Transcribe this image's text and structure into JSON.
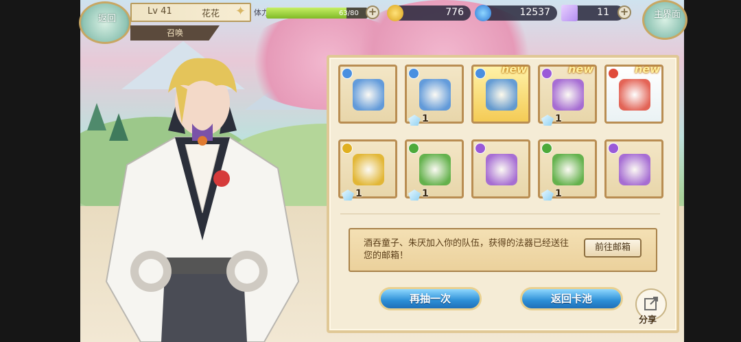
{
  "header": {
    "back_label": "返回",
    "level": "Lv 41",
    "player_name": "花花",
    "summon_tag": "召唤",
    "stamina_label": "体力",
    "stamina_value": "63/80",
    "stamina_fraction": 0.79,
    "gold": "776",
    "gems": "12537",
    "crystals": "11",
    "home_label": "主界面"
  },
  "items": [
    {
      "element_color": "#4a8fe0",
      "new": "",
      "count": "",
      "icon": "mask-artifact-icon"
    },
    {
      "element_color": "#4a8fe0",
      "new": "",
      "count": "1",
      "icon": "gourd-icon"
    },
    {
      "element_color": "#4a8fe0",
      "new": "new",
      "count": "",
      "icon": "dragon-disc-icon"
    },
    {
      "element_color": "#9a5ad8",
      "new": "new",
      "count": "1",
      "icon": "star-shuriken-icon"
    },
    {
      "element_color": "#e04a3a",
      "new": "new",
      "count": "",
      "icon": "golden-rings-icon"
    },
    {
      "element_color": "#e0b020",
      "new": "",
      "count": "1",
      "icon": "earrings-icon"
    },
    {
      "element_color": "#4caa3a",
      "new": "",
      "count": "1",
      "icon": "yellow-flag-icon"
    },
    {
      "element_color": "#9a5ad8",
      "new": "",
      "count": "",
      "icon": "character-fragment-icon"
    },
    {
      "element_color": "#4caa3a",
      "new": "",
      "count": "1",
      "icon": "crossbow-icon"
    },
    {
      "element_color": "#9a5ad8",
      "new": "",
      "count": "",
      "icon": "character-fragment-icon"
    }
  ],
  "message": "酒吞童子、朱厌加入你的队伍，获得的法器已经送往您的邮箱！",
  "mail_button": "前往邮箱",
  "draw_again": "再抽一次",
  "back_pool": "返回卡池",
  "share_label": "分享",
  "colors": {
    "accent_blue": "#2c8fd6",
    "panel_border": "#e0c896"
  }
}
